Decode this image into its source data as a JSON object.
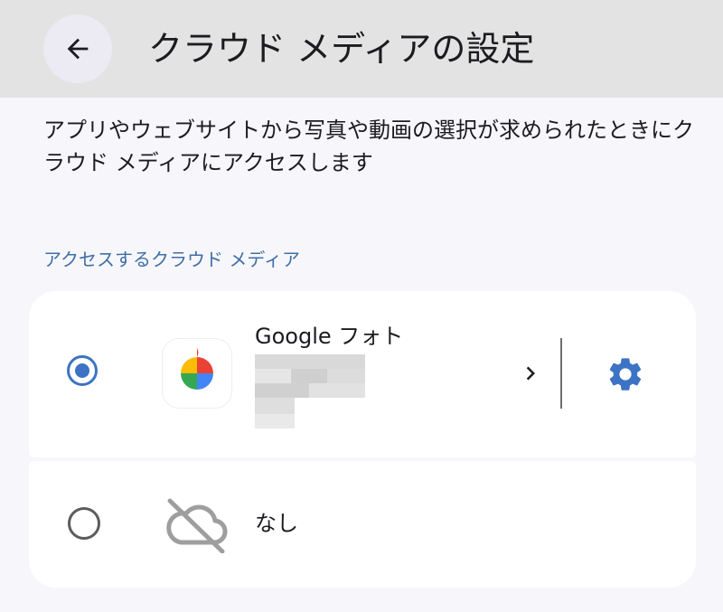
{
  "header": {
    "title": "クラウド メディアの設定",
    "back_icon": "arrow-back-icon"
  },
  "description": "アプリやウェブサイトから写真や動画の選択が求められたときにクラウド メディアにアクセスします",
  "section": {
    "title": "アクセスするクラウド メディア"
  },
  "providers": [
    {
      "name": "Google フォト",
      "account": "",
      "selected": true,
      "icon": "google-photos-icon",
      "chevron_icon": "chevron-right-icon",
      "settings_icon": "gear-icon"
    },
    {
      "name": "なし",
      "selected": false,
      "icon": "cloud-off-icon"
    }
  ],
  "colors": {
    "accent": "#3d73c4",
    "section_header": "#3f6fa6",
    "top_bar": "#e3e3e3",
    "background": "#f7f7fb",
    "card": "#ffffff"
  }
}
